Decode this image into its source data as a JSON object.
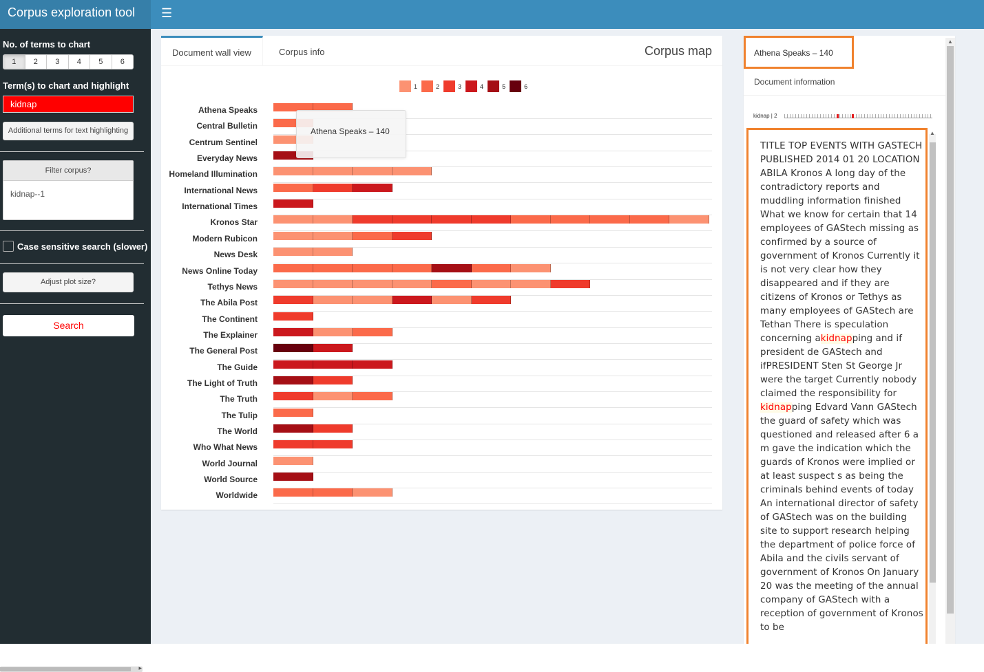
{
  "app": {
    "title": "Corpus exploration tool"
  },
  "sidebar": {
    "num_terms_label": "No. of terms to chart",
    "num_terms_options": [
      "1",
      "2",
      "3",
      "4",
      "5",
      "6"
    ],
    "num_terms_selected": "1",
    "terms_label": "Term(s) to chart and highlight",
    "terms_value": "kidnap",
    "additional_terms_button": "Additional terms for text highlighting",
    "filter_button": "Filter corpus?",
    "filter_value": "kidnap--1",
    "case_sensitive_label": "Case sensitive search (slower)",
    "case_sensitive_checked": false,
    "adjust_plot_button": "Adjust plot size?",
    "search_button": "Search",
    "colors": {
      "search_text": "#ff0000",
      "term_bg": "#ff0000"
    }
  },
  "main": {
    "tabs": [
      {
        "label": "Document wall view",
        "active": true
      },
      {
        "label": "Corpus info",
        "active": false
      }
    ],
    "title": "Corpus map",
    "tooltip": "Athena Speaks – 140"
  },
  "chart_data": {
    "type": "heatmap",
    "title": "Corpus map",
    "legend": [
      {
        "label": "1",
        "color": "#fc9272"
      },
      {
        "label": "2",
        "color": "#fb6a4a"
      },
      {
        "label": "3",
        "color": "#ef3b2c"
      },
      {
        "label": "4",
        "color": "#cb181d"
      },
      {
        "label": "5",
        "color": "#a50f15"
      },
      {
        "label": "6",
        "color": "#67000d"
      }
    ],
    "rows": [
      {
        "name": "Athena Speaks",
        "values": [
          2,
          2
        ]
      },
      {
        "name": "Central Bulletin",
        "values": [
          2
        ]
      },
      {
        "name": "Centrum Sentinel",
        "values": [
          1
        ]
      },
      {
        "name": "Everyday News",
        "values": [
          5
        ]
      },
      {
        "name": "Homeland Illumination",
        "values": [
          1,
          1,
          1,
          1
        ]
      },
      {
        "name": "International News",
        "values": [
          2,
          3,
          4
        ]
      },
      {
        "name": "International Times",
        "values": [
          4
        ]
      },
      {
        "name": "Kronos Star",
        "values": [
          1,
          1,
          3,
          3,
          3,
          3,
          2,
          2,
          2,
          2,
          1
        ]
      },
      {
        "name": "Modern Rubicon",
        "values": [
          1,
          1,
          2,
          3
        ]
      },
      {
        "name": "News Desk",
        "values": [
          1,
          1
        ]
      },
      {
        "name": "News Online Today",
        "values": [
          2,
          2,
          2,
          2,
          5,
          2,
          1
        ]
      },
      {
        "name": "Tethys News",
        "values": [
          1,
          1,
          1,
          1,
          2,
          1,
          1,
          3
        ]
      },
      {
        "name": "The Abila Post",
        "values": [
          3,
          1,
          1,
          4,
          1,
          3
        ]
      },
      {
        "name": "The Continent",
        "values": [
          3
        ]
      },
      {
        "name": "The Explainer",
        "values": [
          4,
          1,
          2
        ]
      },
      {
        "name": "The General Post",
        "values": [
          6,
          4
        ]
      },
      {
        "name": "The Guide",
        "values": [
          4,
          4,
          4
        ]
      },
      {
        "name": "The Light of Truth",
        "values": [
          5,
          3
        ]
      },
      {
        "name": "The Truth",
        "values": [
          3,
          1,
          2
        ]
      },
      {
        "name": "The Tulip",
        "values": [
          2
        ]
      },
      {
        "name": "The World",
        "values": [
          5,
          3
        ]
      },
      {
        "name": "Who What News",
        "values": [
          3,
          3
        ]
      },
      {
        "name": "World Journal",
        "values": [
          1
        ]
      },
      {
        "name": "World Source",
        "values": [
          5
        ]
      },
      {
        "name": "Worldwide",
        "values": [
          2,
          2,
          1
        ]
      }
    ]
  },
  "document": {
    "title": "Athena Speaks – 140",
    "info_tab": "Document information",
    "map_label": "kidnap | 2",
    "segments": [
      {
        "t": "TITLE TOP EVENTS WITH GASTECH PUBLISHED 2014 01 20 LOCATION ABILA Kronos A long day of the contradictory reports and muddling information finished What we know for certain that 14 employees of GAStech missing as confirmed by a source of government of Kronos Currently it is not very clear how they disappeared and if they are citizens of Kronos or Tethys as many employees of GAStech are Tethan There is speculation concerning a"
      },
      {
        "t": "kidnap",
        "hl": true
      },
      {
        "t": "ping and if president de GAStech and ifPRESIDENT Sten St George Jr were the target Currently nobody claimed the responsibility for "
      },
      {
        "t": "kidnap",
        "hl": true
      },
      {
        "t": "ping Edvard Vann GAStech the guard of safety which was questioned and released after 6 a m gave the indication which the guards of Kronos were implied or at least suspect s as being the criminals behind events of today An international director of safety of GAStech was on the building site to support research helping the department of police force of Abila and the civils servant of government of Kronos On January 20 was the meeting of the annual company of GAStech with a reception of government of Kronos to be"
      }
    ]
  }
}
